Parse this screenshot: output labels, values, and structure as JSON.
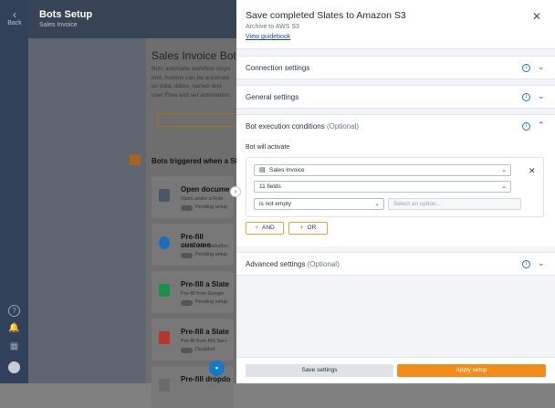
{
  "rail": {
    "back_label": "Back",
    "icons": [
      "help-icon",
      "bell-icon",
      "building-icon",
      "avatar"
    ]
  },
  "background": {
    "title": "Bots Setup",
    "subtitle": "Sales Invoice",
    "heading": "Sales Invoice Bots",
    "description": "Bots automate workflow steps met. Actions can be automate as data, dates, names and user Flow and set automation.",
    "triggered_label": "Bots triggered when a Slate",
    "cards": [
      {
        "title": "Open docume",
        "desc": "Open under a Role",
        "status": "Pending setup",
        "color": "#4a5568"
      },
      {
        "title": "Pre-fill custome",
        "desc": "Pre-fill from Salesforc",
        "status": "Pending setup",
        "color": "#1b6fb8"
      },
      {
        "title": "Pre-fill a Slate",
        "desc": "Pre-fill from Google",
        "status": "Pending setup",
        "color": "#1e8e4e"
      },
      {
        "title": "Pre-fill a Slate",
        "desc": "Pre-fill from MS Serv",
        "status": "Disabled",
        "color": "#b5362e"
      },
      {
        "title": "Pre-fill dropdo",
        "desc": "",
        "status": "",
        "color": "#6b6b6b"
      }
    ]
  },
  "panel": {
    "title": "Save completed Slates to Amazon S3",
    "subtitle": "Archive to AWS S3",
    "guide_link": "View guidebook",
    "sections": {
      "connection": "Connection settings",
      "general": "General settings",
      "execution": "Bot execution conditions",
      "execution_opt": "(Optional)",
      "advanced": "Advanced settings",
      "advanced_opt": "(Optional)"
    },
    "will_activate": "Bot will activate",
    "condition": {
      "document": "Sales Invoice",
      "fields": "11 fields",
      "operator": "is not empty",
      "option_placeholder": "Select an option..."
    },
    "and_label": "AND",
    "or_label": "OR",
    "save_label": "Save settings",
    "apply_label": "Apply setup"
  }
}
